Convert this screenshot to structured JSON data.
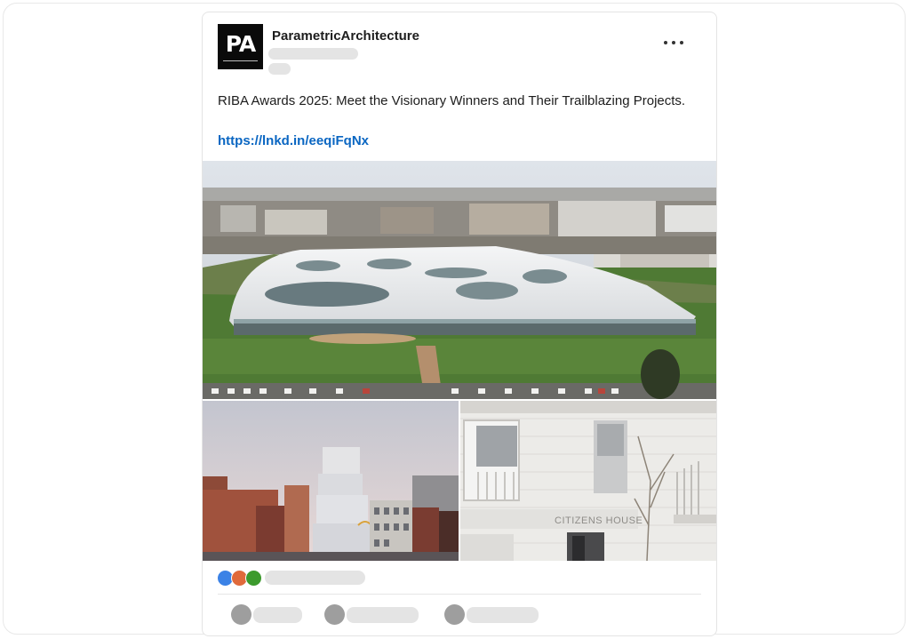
{
  "post": {
    "author": "ParametricArchitecture",
    "logo_text": "PA",
    "text": "RIBA Awards 2025: Meet the Visionary Winners and Their Trailblazing Projects.",
    "link": "https://lnkd.in/eeqiFqNx"
  },
  "images": [
    {
      "name": "wave-roof-building-aerial-photo"
    },
    {
      "name": "stacked-box-museum-photo"
    },
    {
      "name": "citizens-house-facade-photo",
      "sign": "CITIZENS HOUSE"
    }
  ],
  "reactions": {
    "colors": [
      "#3b82e6",
      "#e06a3b",
      "#3c9a2d"
    ]
  },
  "icons": [
    "more-options-icon",
    "reaction-icon",
    "action-icon"
  ],
  "colors": {
    "link": "#0a66c2",
    "skeleton": "#e4e4e4",
    "action_icon": "#9e9e9e"
  }
}
